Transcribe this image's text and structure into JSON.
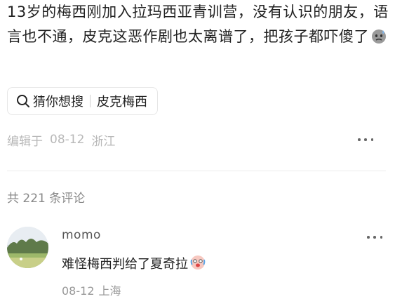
{
  "post": {
    "text": "13岁的梅西刚加入拉玛西亚青训营，没有认识的朋友，语言也不通，皮克这恶作剧也太离谱了，把孩子都吓傻了",
    "emoji_icon": "sweat-face-icon"
  },
  "search": {
    "label": "猜你想搜",
    "query": "皮克梅西"
  },
  "meta": {
    "edited": "编辑于",
    "date": "08-12",
    "location": "浙江"
  },
  "comments_header": {
    "prefix": "共",
    "count": "221",
    "suffix": "条评论"
  },
  "comments": [
    {
      "username": "momo",
      "text": "难怪梅西判给了夏奇拉",
      "emoji_icon": "crying-face-icon",
      "date": "08-12",
      "location": "上海"
    }
  ]
}
